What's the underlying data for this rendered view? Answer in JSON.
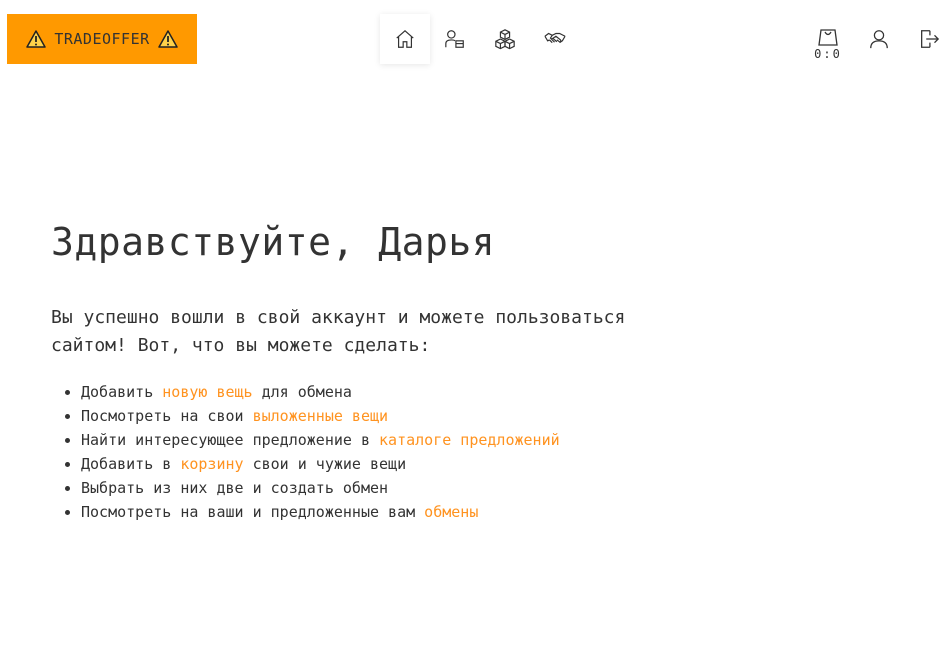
{
  "header": {
    "logo_text": "TRADEOFFER",
    "nav": [
      {
        "icon": "home-icon",
        "active": true
      },
      {
        "icon": "user-items-icon",
        "active": false
      },
      {
        "icon": "boxes-icon",
        "active": false
      },
      {
        "icon": "handshake-icon",
        "active": false
      }
    ],
    "cart_count": "0:0"
  },
  "main": {
    "greeting": "Здравствуйте, Дарья",
    "intro": "Вы успешно вошли в свой аккаунт и можете пользоваться сайтом! Вот, что вы можете сделать:",
    "items": [
      {
        "before": "Добавить ",
        "link": "новую вещь",
        "after": " для обмена"
      },
      {
        "before": "Посмотреть на свои ",
        "link": "выложенные вещи",
        "after": ""
      },
      {
        "before": "Найти интересующее предложение в ",
        "link": "каталоге предложений",
        "after": ""
      },
      {
        "before": "Добавить в ",
        "link": "корзину",
        "after": " свои и чужие вещи"
      },
      {
        "before": "Выбрать из них две и создать обмен",
        "link": "",
        "after": ""
      },
      {
        "before": "Посмотреть на ваши и предложенные вам ",
        "link": "обмены",
        "after": ""
      }
    ]
  },
  "colors": {
    "accent": "#ff9900",
    "link": "#ff9320",
    "text": "#333333"
  }
}
